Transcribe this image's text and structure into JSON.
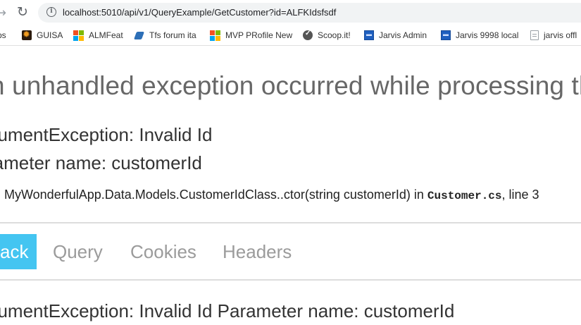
{
  "browser": {
    "url": "localhost:5010/api/v1/QueryExample/GetCustomer?id=ALFKIdsfsdf",
    "bookmarks": [
      {
        "label": "ps",
        "icon": "apps-icon"
      },
      {
        "label": "GUISA",
        "icon": "guisa-icon"
      },
      {
        "label": "ALMFeat",
        "icon": "microsoft-icon"
      },
      {
        "label": "Tfs forum ita",
        "icon": "tfs-icon"
      },
      {
        "label": "MVP PRofile New",
        "icon": "microsoft-icon"
      },
      {
        "label": "Scoop.it!",
        "icon": "scoopit-icon"
      },
      {
        "label": "Jarvis Admin",
        "icon": "jarvis-icon"
      },
      {
        "label": "Jarvis 9998 local",
        "icon": "jarvis-icon"
      },
      {
        "label": "jarvis offl",
        "icon": "page-icon"
      }
    ]
  },
  "error": {
    "title": "n unhandled exception occurred while processing th",
    "exception_type": "gumentException: Invalid Id",
    "parameter": "rameter name: customerId",
    "location_prefix": "MyWonderfulApp.Data.Models.CustomerIdClass..ctor(string customerId) in ",
    "location_file": "Customer.cs",
    "location_suffix": ", line 3",
    "stack_message": "gumentException: Invalid Id Parameter name: customerId"
  },
  "tabs": [
    {
      "label": "ack",
      "active": true
    },
    {
      "label": "Query",
      "active": false
    },
    {
      "label": "Cookies",
      "active": false
    },
    {
      "label": "Headers",
      "active": false
    }
  ],
  "colors": {
    "active_tab": "#44c5f1",
    "inactive_tab_text": "#9b9b9b",
    "title_text": "#676767",
    "divider": "#dddddd"
  }
}
